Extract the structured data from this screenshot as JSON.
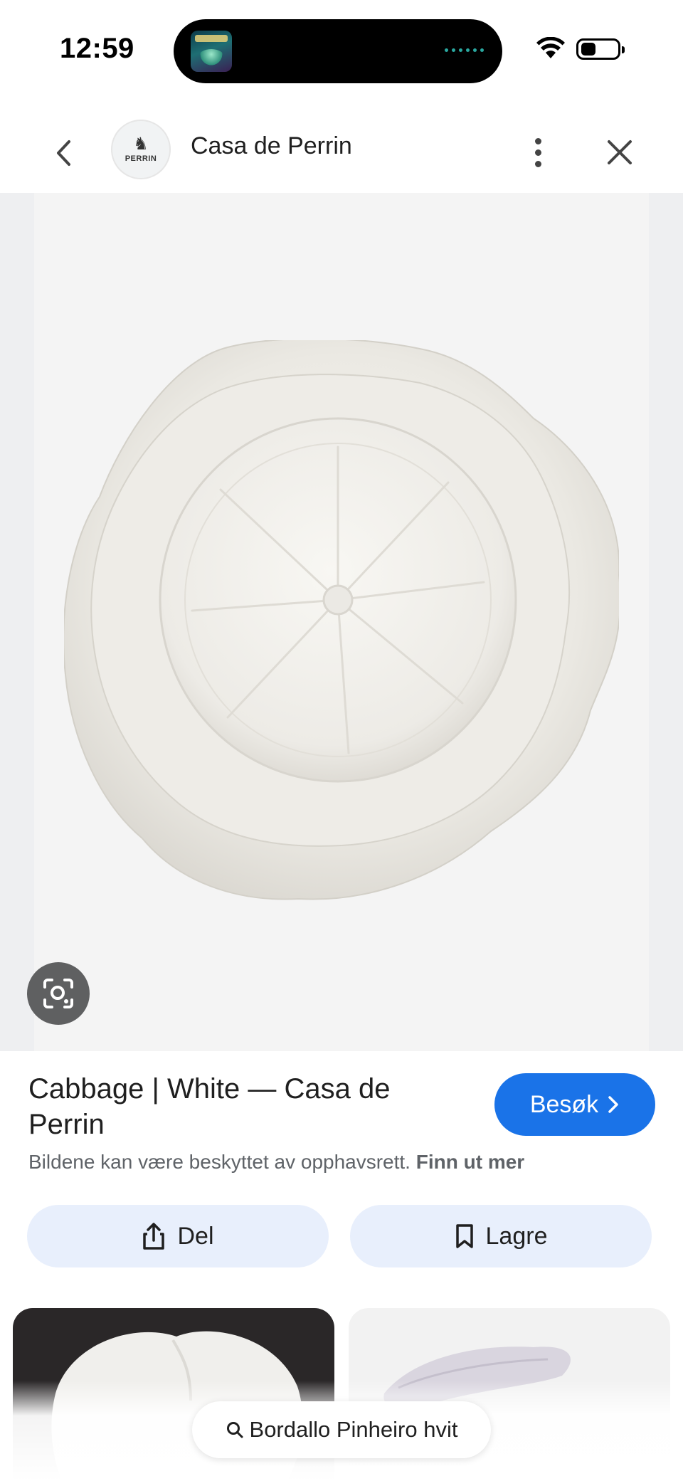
{
  "status_bar": {
    "time": "12:59",
    "now_playing_art": "Harry Potter",
    "icons": [
      "wifi-icon",
      "battery-icon"
    ]
  },
  "header": {
    "site_name": "Casa de Perrin",
    "logo_text": "PERRIN",
    "icons": [
      "chevron-left-icon",
      "more-vert-icon",
      "close-icon"
    ]
  },
  "image": {
    "icons": [
      "lens-icon"
    ]
  },
  "result": {
    "title": "Cabbage | White — Casa de Perrin",
    "visit_label": "Besøk",
    "copyright_text": "Bildene kan være beskyttet av opphavsrett.",
    "learn_more_label": "Finn ut mer"
  },
  "actions": {
    "share_label": "Del",
    "save_label": "Lagre",
    "icons": [
      "share-icon",
      "bookmark-icon"
    ]
  },
  "search_chip": {
    "query": "Bordallo Pinheiro hvit",
    "icon": "search-icon"
  },
  "colors": {
    "accent": "#1a73e8",
    "action_bg": "#e8effc",
    "image_bg": "#f4f4f4",
    "lens_bg": "#5f6061"
  }
}
